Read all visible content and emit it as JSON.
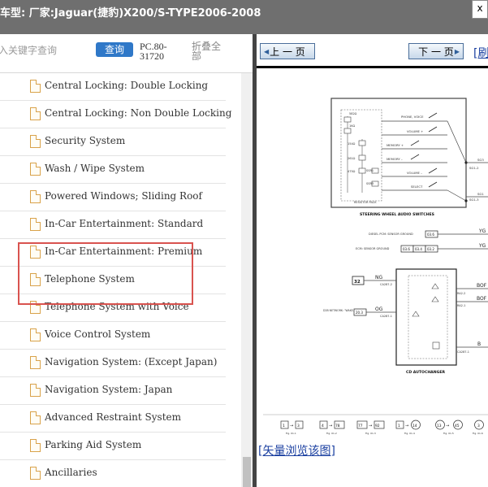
{
  "window": {
    "title": "车型:  厂家:Jaguar(捷豹)X200/S-TYPE2006-2008",
    "close_glyph": "x"
  },
  "search": {
    "placeholder": "入关键字查询",
    "button_label": "查询",
    "pc_code": "PC.80-31720",
    "collapse_label": "折叠全部"
  },
  "tree": {
    "items": [
      {
        "label": "Central Locking: Double Locking"
      },
      {
        "label": "Central Locking: Non Double Locking"
      },
      {
        "label": "Security System"
      },
      {
        "label": "Wash / Wipe System"
      },
      {
        "label": "Powered Windows; Sliding Roof"
      },
      {
        "label": "In-Car Entertainment: Standard"
      },
      {
        "label": "In-Car Entertainment: Premium"
      },
      {
        "label": "Telephone System"
      },
      {
        "label": "Telephone System with Voice"
      },
      {
        "label": "Voice Control System"
      },
      {
        "label": "Navigation System: (Except Japan)"
      },
      {
        "label": "Navigation System: Japan"
      },
      {
        "label": "Advanced Restraint System"
      },
      {
        "label": "Parking Aid System"
      },
      {
        "label": "Ancillaries"
      }
    ],
    "highlight_color": "#d9534f"
  },
  "viewer": {
    "prev_label": "上 一 页",
    "next_label": "下 一 页",
    "more_link": "[刷",
    "vector_link": "[矢量浏览该图]"
  },
  "diagram": {
    "switches_title": "STEERING WHEEL AUDIO SWITCHES",
    "resistor_pack": "RESISTOR PACK",
    "resistors": [
      "582Ω",
      "1KΩ",
      "154Ω",
      "261Ω",
      "475Ω"
    ],
    "resistor_ids": [
      "SSR1",
      "SSR3"
    ],
    "switch_labels": [
      "PHONE, VOICE",
      "VOLUME +",
      "MEMORY +",
      "MEMORY –",
      "VOLUME –",
      "SELECT"
    ],
    "connectors": [
      "SG1-2",
      "SG1-3",
      "SG3",
      "SG1"
    ],
    "diesel_label": "DIESEL PCM: SENSOR GROUND",
    "diesel_ref": "03.6",
    "ecm_label": "ECM: SENSOR GROUND",
    "ecm_refs": [
      "03.6",
      "03.4",
      "03.2"
    ],
    "wire_yg": "YG",
    "ref_32": "32",
    "wire_ng": "NG",
    "ng_conn": "CA287-2",
    "d2b_label": "D2B NETWORK: \"WAKE-UP\"",
    "d2b_ref": "20.3",
    "wire_og": "OG",
    "og_conn": "CA287-1",
    "ra_conns": [
      "RA2-2",
      "RA2-1"
    ],
    "wire_bof": "BOF",
    "wire_b": "B",
    "ca_conn": "CA287-1",
    "changer_title": "CD AUTOCHANGER",
    "footer_refs": [
      {
        "from": "1",
        "to": "3",
        "fig": "Fig. 01.1"
      },
      {
        "from": "4",
        "to": "78",
        "fig": "Fig. 01.2"
      },
      {
        "from": "77",
        "to": "92",
        "fig": "Fig. 01.3"
      },
      {
        "from": "1",
        "to": "14",
        "fig": "Fig. 01.4"
      },
      {
        "from": "13",
        "to": "45",
        "fig": "Fig. 01.5"
      },
      {
        "from": "3",
        "to": "",
        "fig": "Fig. 01.6"
      }
    ]
  }
}
